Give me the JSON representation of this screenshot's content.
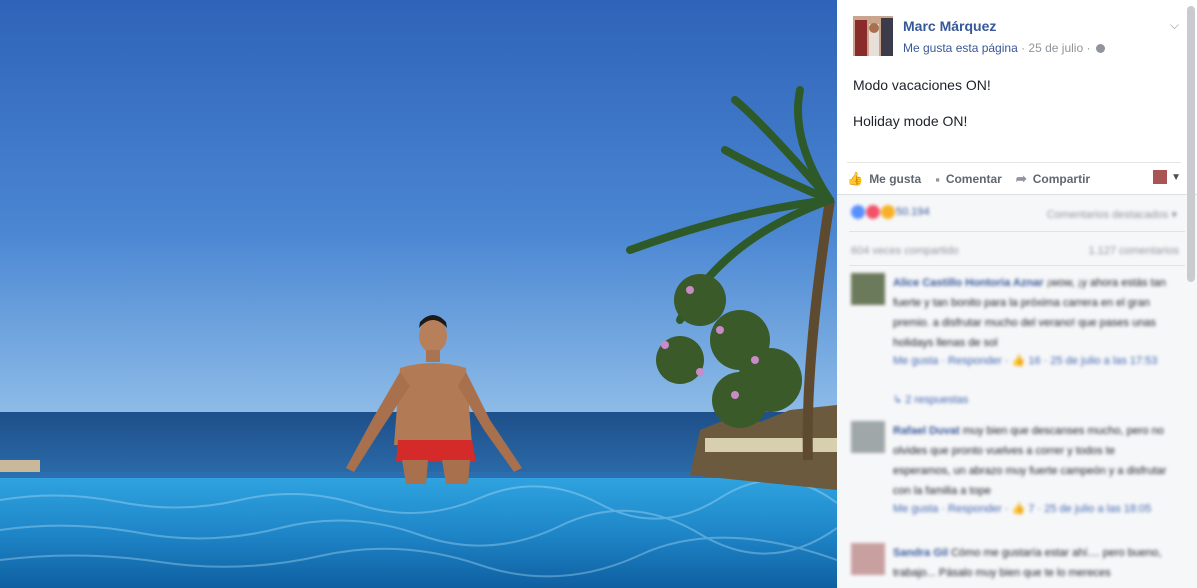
{
  "post": {
    "author": "Marc Márquez",
    "like_page": "Me gusta esta página",
    "separator": " · ",
    "date": "25 de julio",
    "text_line1": "Modo vacaciones ON!",
    "text_line2": "Holiday mode ON!",
    "chevron": "⌵"
  },
  "actions": {
    "like_label": "Me gusta",
    "comment_label": "Comentar",
    "share_label": "Compartir",
    "like_icon": "👍",
    "comment_icon": "▪",
    "share_icon": "➦",
    "caret": "▼"
  },
  "stats": {
    "reactions_count": "50.194",
    "top_comments": "Comentarios destacados ▾",
    "shares": "604 veces compartido",
    "comments_count": "1.127 comentarios"
  },
  "comments": [
    {
      "author": "Alice Castillo Hontoria Aznar",
      "text": "¡wow, ¡y ahora estás tan fuerte y tan bonito para la próxima carrera en el gran premio. a disfrutar mucho del verano! que pases unas holidays llenas de sol",
      "links": "Me gusta · Responder · 👍 16 · 25 de julio a las 17:53",
      "replies": "↳ 2 respuestas"
    },
    {
      "author": "Rafael Duvat",
      "text": "muy bien que descanses mucho, pero no olvides que pronto vuelves a correr y todos te esperamos, un abrazo muy fuerte campeón y a disfrutar con la familia a tope",
      "links": "Me gusta · Responder · 👍 7 · 25 de julio a las 18:05"
    },
    {
      "author": "Sandra Gil",
      "text": "Cómo me gustaría estar ahí.... pero bueno, trabajo... Pásalo muy bien que te lo mereces"
    }
  ]
}
